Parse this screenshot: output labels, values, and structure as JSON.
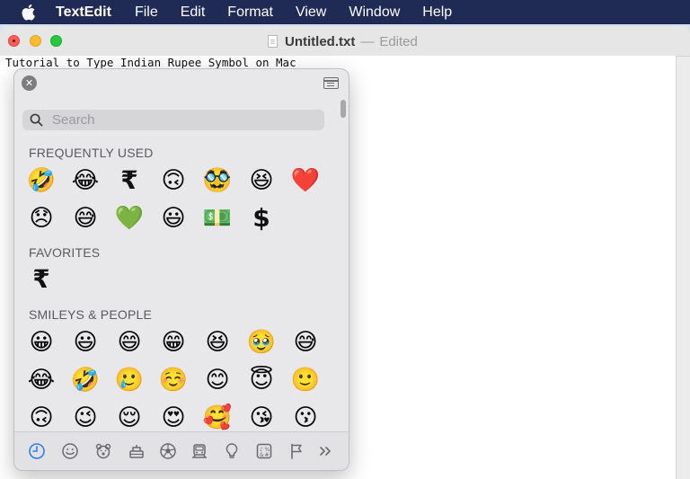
{
  "menubar": {
    "app_name": "TextEdit",
    "items": [
      "File",
      "Edit",
      "Format",
      "View",
      "Window",
      "Help"
    ]
  },
  "window": {
    "title": "Untitled.txt",
    "separator": "—",
    "status": "Edited"
  },
  "document": {
    "text": "Tutorial to Type Indian Rupee Symbol on Mac"
  },
  "picker": {
    "search_placeholder": "Search",
    "sections": [
      {
        "title": "FREQUENTLY USED",
        "rows": [
          [
            "🤣",
            "😂",
            "₹",
            "🙃",
            "🥸",
            "😆",
            "❤️"
          ],
          [
            "😞",
            "😅",
            "💚",
            "😃",
            "💵",
            "$"
          ]
        ]
      },
      {
        "title": "FAVORITES",
        "rows": [
          [
            "₹"
          ]
        ]
      },
      {
        "title": "SMILEYS & PEOPLE",
        "rows": [
          [
            "😀",
            "😃",
            "😄",
            "😁",
            "😆",
            "🥹",
            "😅"
          ],
          [
            "😂",
            "🤣",
            "🥲",
            "☺️",
            "😊",
            "😇",
            "🙂"
          ],
          [
            "🙃",
            "😉",
            "😌",
            "😍",
            "🥰",
            "😘",
            "😗"
          ]
        ]
      }
    ],
    "categories": [
      {
        "name": "recent-icon",
        "label": "Frequently Used"
      },
      {
        "name": "smiley-icon",
        "label": "Smileys & People"
      },
      {
        "name": "animal-icon",
        "label": "Animals & Nature"
      },
      {
        "name": "food-icon",
        "label": "Food & Drink"
      },
      {
        "name": "ball-icon",
        "label": "Activity"
      },
      {
        "name": "car-icon",
        "label": "Travel & Places"
      },
      {
        "name": "lightbulb-icon",
        "label": "Objects"
      },
      {
        "name": "symbols-icon",
        "label": "Symbols"
      },
      {
        "name": "flag-icon",
        "label": "Flags"
      },
      {
        "name": "more-icon",
        "label": "More"
      }
    ],
    "accent_color": "#2f7cf6"
  }
}
